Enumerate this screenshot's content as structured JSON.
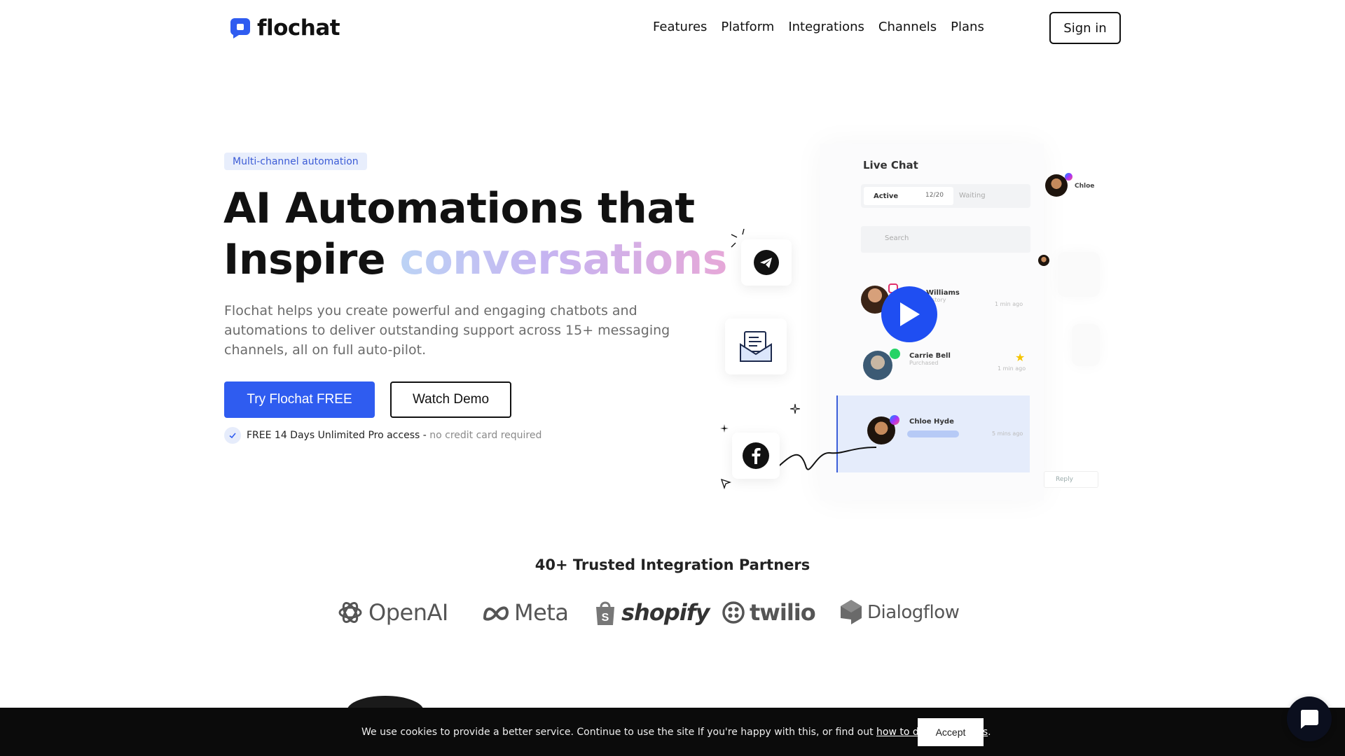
{
  "brand": {
    "name": "flochat",
    "accent": "#2f5cf0"
  },
  "nav": {
    "items": [
      "Features",
      "Platform",
      "Integrations",
      "Channels",
      "Plans"
    ],
    "sign_in": "Sign in"
  },
  "hero": {
    "badge": "Multi-channel automation",
    "headline_line1": "AI Automations that",
    "headline_line2_plain": "Inspire ",
    "headline_line2_gradient": "conversations",
    "description": "Flochat helps you create powerful and engaging chatbots and automations to deliver outstanding support across 15+ messaging channels, all on full auto-pilot.",
    "primary_cta": "Try Flochat FREE",
    "secondary_cta": "Watch Demo",
    "free_note_strong": "FREE 14 Days Unlimited Pro access - ",
    "free_note_muted": "no credit card required"
  },
  "illustration": {
    "panel_title": "Live Chat",
    "tab_active": "Active",
    "tab_count": "12/20",
    "tab_waiting": "Waiting",
    "search_placeholder": "Search",
    "chats": [
      {
        "name": "Williams",
        "sub": "History",
        "time": "1 min ago",
        "channel": "instagram-icon"
      },
      {
        "name": "Carrie Bell",
        "sub": "Purchased",
        "time": "1 min ago",
        "channel": "whatsapp-icon"
      },
      {
        "name": "Chloe Hyde",
        "sub": "",
        "time": "5 mins ago",
        "channel": "messenger-icon"
      }
    ],
    "side_name": "Chloe",
    "reply": "Reply",
    "floating_icons": [
      "telegram-icon",
      "email-icon",
      "facebook-icon"
    ]
  },
  "partners": {
    "title": "40+ Trusted Integration Partners",
    "logos": [
      "OpenAI",
      "Meta",
      "shopify",
      "twilio",
      "Dialogflow"
    ]
  },
  "cookie": {
    "text": "We use cookies to provide a better service. Continue to use the site If you're happy with this, or find out ",
    "link": "how to disable cookies",
    "end": ".",
    "accept": "Accept"
  }
}
